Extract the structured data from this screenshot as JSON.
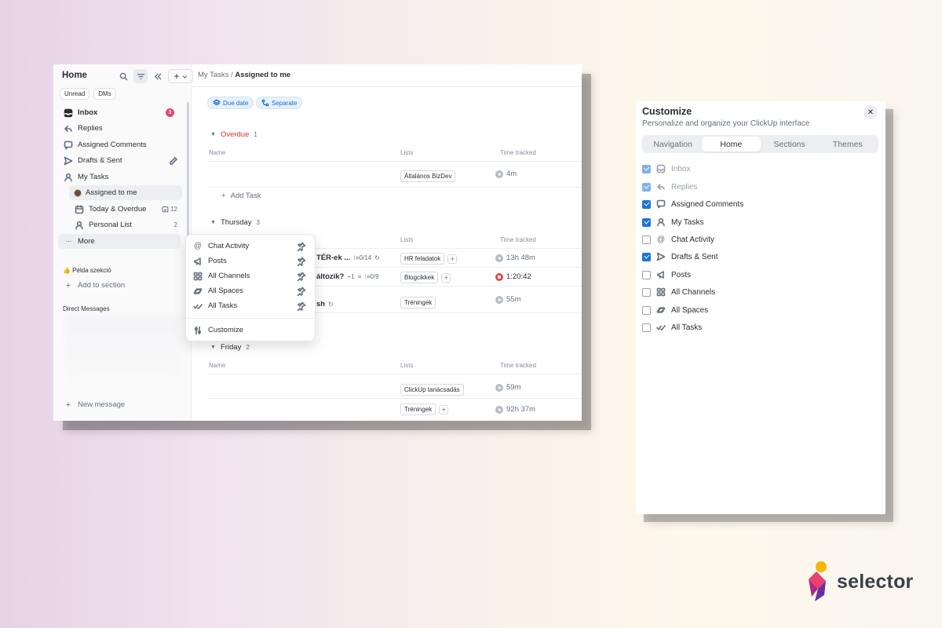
{
  "sidebar": {
    "title": "Home",
    "pills": [
      "Unread",
      "DMs"
    ],
    "items": [
      {
        "label": "Inbox",
        "icon": "inbox-icon",
        "badge": "3"
      },
      {
        "label": "Replies",
        "icon": "reply-icon"
      },
      {
        "label": "Assigned Comments",
        "icon": "comment-icon"
      },
      {
        "label": "Drafts & Sent",
        "icon": "send-icon"
      },
      {
        "label": "My Tasks",
        "icon": "user-icon"
      }
    ],
    "sub_items": [
      {
        "label": "Assigned to me",
        "icon": "avatar"
      },
      {
        "label": "Today & Overdue",
        "icon": "calendar-icon",
        "count": "12"
      },
      {
        "label": "Personal List",
        "icon": "user-icon",
        "count": "2"
      }
    ],
    "more_label": "More",
    "section_label": "👍 Példa szekció",
    "add_section": "Add to section",
    "direct_messages": "Direct Messages",
    "new_message": "New message"
  },
  "breadcrumb": {
    "parent": "My Tasks",
    "separator": "/",
    "current": "Assigned to me"
  },
  "chips": [
    "Due date",
    "Separate"
  ],
  "columns": {
    "name": "Name",
    "lists": "Lists",
    "time": "Time tracked"
  },
  "groups": {
    "overdue": {
      "label": "Overdue",
      "count": "1",
      "color": "#d1342f",
      "rows": [
        {
          "list": "Általános BizDev",
          "time": "4m"
        }
      ],
      "add_task": "Add Task"
    },
    "thursday": {
      "label": "Thursday",
      "count": "3",
      "rows": [
        {
          "name": "TÉR-ek ...",
          "meta": "0/14",
          "list": "HR feladatok",
          "time": "13h 48m"
        },
        {
          "name": "áltozik?",
          "meta1": "1",
          "meta2": "0/9",
          "list": "Blogcikkek",
          "time": "1:20:42"
        },
        {
          "name": "sh",
          "list": "Tréningek",
          "time": "55m"
        }
      ]
    },
    "friday": {
      "label": "Friday",
      "count": "2",
      "rows": [
        {
          "list": "ClickUp tanácsadás",
          "time": "59m"
        },
        {
          "list": "Tréningek",
          "time": "92h 37m"
        }
      ]
    }
  },
  "menu": {
    "items": [
      {
        "label": "Chat Activity",
        "icon": "at-icon"
      },
      {
        "label": "Posts",
        "icon": "megaphone-icon"
      },
      {
        "label": "All Channels",
        "icon": "grid-icon"
      },
      {
        "label": "All Spaces",
        "icon": "planet-icon"
      },
      {
        "label": "All Tasks",
        "icon": "check-double-icon"
      }
    ],
    "customize": "Customize"
  },
  "customize": {
    "title": "Customize",
    "subtitle": "Personalize and organize your ClickUp interface",
    "tabs": [
      "Navigation",
      "Home",
      "Sections",
      "Themes"
    ],
    "active_tab": "Home",
    "options": [
      {
        "label": "Inbox",
        "checked": true,
        "disabled": true,
        "icon": "inbox-icon"
      },
      {
        "label": "Replies",
        "checked": true,
        "disabled": true,
        "icon": "reply-icon"
      },
      {
        "label": "Assigned Comments",
        "checked": true,
        "icon": "comment-icon"
      },
      {
        "label": "My Tasks",
        "checked": true,
        "icon": "user-icon"
      },
      {
        "label": "Chat Activity",
        "checked": false,
        "icon": "at-icon"
      },
      {
        "label": "Drafts & Sent",
        "checked": true,
        "icon": "send-icon"
      },
      {
        "label": "Posts",
        "checked": false,
        "icon": "megaphone-icon"
      },
      {
        "label": "All Channels",
        "checked": false,
        "icon": "grid-icon"
      },
      {
        "label": "All Spaces",
        "checked": false,
        "icon": "planet-icon"
      },
      {
        "label": "All Tasks",
        "checked": false,
        "icon": "check-double-icon"
      }
    ]
  },
  "logo": {
    "text": "selector"
  },
  "colors": {
    "accent": "#1c75d8",
    "badge": "#e8436b",
    "overdue": "#d1342f"
  }
}
